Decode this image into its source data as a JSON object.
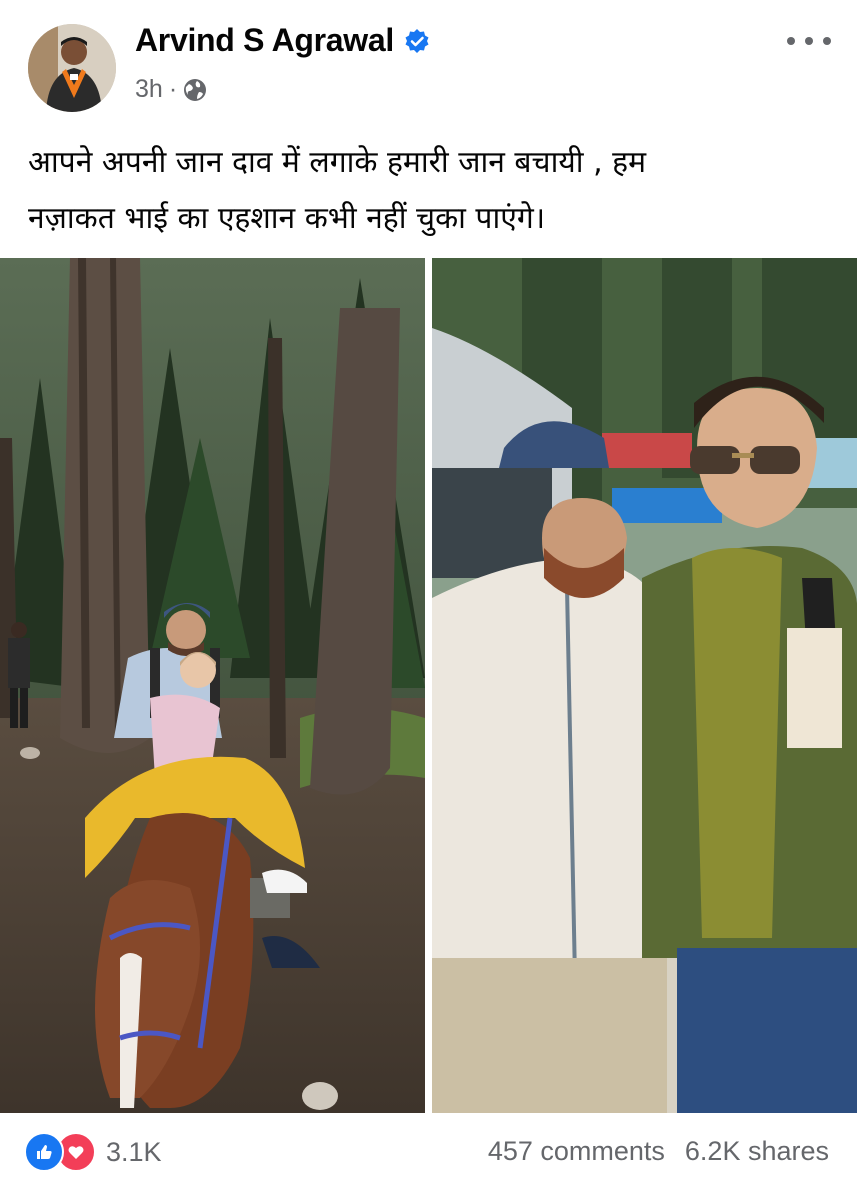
{
  "post": {
    "author": "Arvind S Agrawal",
    "time": "3h",
    "separator": "·",
    "text_line1": "आपने अपनी जान दाव में  लगाके हमारी जान बचायी , हम",
    "text_line2": "नज़ाकत भाई का एहशान कभी नहीं चुका पाएंगे।"
  },
  "icons": {
    "verified": "verified-badge-icon",
    "audience": "globe-icon",
    "more": "more-options-icon",
    "like": "like-reaction-icon",
    "love": "love-reaction-icon"
  },
  "footer": {
    "reaction_count": "3.1K",
    "comments": "457 comments",
    "shares": "6.2K shares"
  },
  "colors": {
    "brand_blue": "#1877f2",
    "love_red": "#f33e58",
    "secondary_text": "#65676b"
  }
}
